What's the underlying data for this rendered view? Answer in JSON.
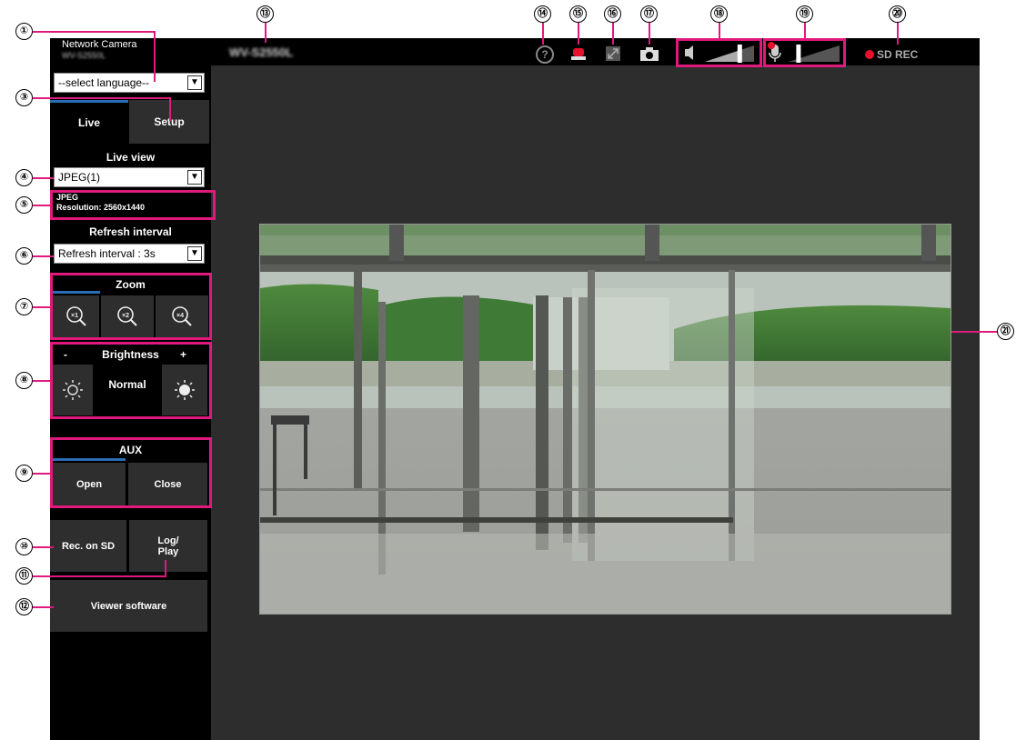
{
  "header": {
    "product_line": "Network Camera",
    "model_small": "WV-S2550L",
    "model_title": "WV-S2550L",
    "sd_rec_label": "SD REC"
  },
  "language": {
    "value": "--select language--"
  },
  "tabs": {
    "live": "Live",
    "setup": "Setup"
  },
  "live_view": {
    "heading": "Live view",
    "stream": "JPEG(1)",
    "info_line1": "JPEG",
    "info_line2": "Resolution: 2560x1440"
  },
  "refresh": {
    "heading": "Refresh interval",
    "value": "Refresh interval : 3s"
  },
  "zoom": {
    "heading": "Zoom",
    "levels": [
      "×1",
      "×2",
      "×4"
    ]
  },
  "brightness": {
    "minus": "-",
    "heading": "Brightness",
    "plus": "+",
    "value": "Normal"
  },
  "aux": {
    "heading": "AUX",
    "open": "Open",
    "close": "Close"
  },
  "buttons": {
    "rec_sd": "Rec. on SD",
    "log_play_1": "Log/",
    "log_play_2": "Play",
    "viewer": "Viewer software"
  },
  "volume": {
    "speaker_level": 0.7,
    "mic_level": 0.15
  },
  "markers": [
    "①",
    "③",
    "④",
    "⑤",
    "⑥",
    "⑦",
    "⑧",
    "⑨",
    "⑩",
    "⑪",
    "⑫",
    "⑬",
    "⑭",
    "⑮",
    "⑯",
    "⑰",
    "⑱",
    "⑲",
    "⑳",
    "㉑"
  ],
  "colors": {
    "callout": "#e0197d",
    "tab_accent": "#2a6db5",
    "rec_dot": "#e8102a",
    "alarm": "#e8102a"
  }
}
